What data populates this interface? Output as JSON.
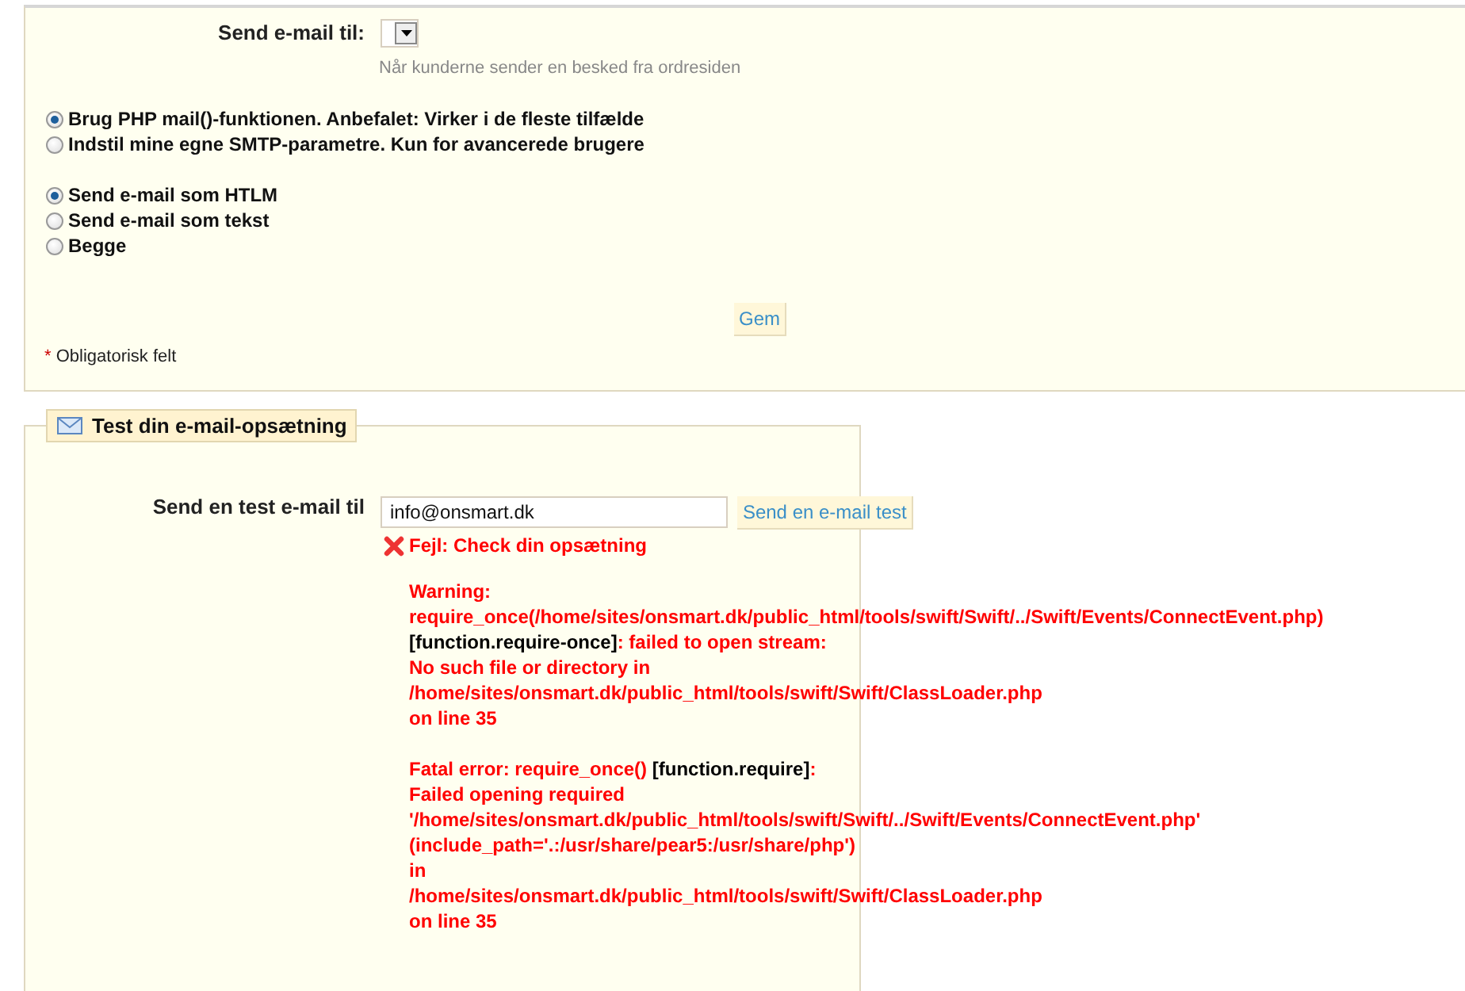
{
  "settings": {
    "send_to": {
      "label": "Send e-mail til:",
      "hint": "Når kunderne sender en besked fra ordresiden"
    },
    "mail_method": [
      {
        "label": "Brug PHP mail()-funktionen. Anbefalet: Virker i de fleste tilfælde",
        "selected": true
      },
      {
        "label": "Indstil mine egne SMTP-parametre. Kun for avancerede brugere",
        "selected": false
      }
    ],
    "mail_format": [
      {
        "label": "Send e-mail som HTLM",
        "selected": true
      },
      {
        "label": "Send e-mail som tekst",
        "selected": false
      },
      {
        "label": "Begge",
        "selected": false
      }
    ],
    "save_button": "Gem",
    "required_note": {
      "mark": "*",
      "text": "Obligatorisk felt"
    }
  },
  "test": {
    "legend": "Test din e-mail-opsætning",
    "label": "Send en test e-mail til",
    "email": "info@onsmart.dk",
    "button": "Send en e-mail test",
    "error": "Fejl: Check din opsætning",
    "messages": [
      [
        [
          {
            "kind": "text",
            "text": "Warning:"
          }
        ],
        [
          {
            "kind": "text",
            "text": "require_once(/home/sites/onsmart.dk/public_html/tools/swift/Swift/../Swift/Events/ConnectEvent.php)"
          }
        ],
        [
          {
            "kind": "link",
            "text": "[function.require-once]"
          },
          {
            "kind": "text",
            "text": ": failed to open stream:"
          }
        ],
        [
          {
            "kind": "text",
            "text": "No such file or directory in"
          }
        ],
        [
          {
            "kind": "text",
            "text": "/home/sites/onsmart.dk/public_html/tools/swift/Swift/ClassLoader.php"
          }
        ],
        [
          {
            "kind": "text",
            "text": "on line 35"
          }
        ]
      ],
      [
        [
          {
            "kind": "text",
            "text": "Fatal error: require_once() "
          },
          {
            "kind": "link",
            "text": "[function.require]"
          },
          {
            "kind": "text",
            "text": ":"
          }
        ],
        [
          {
            "kind": "text",
            "text": "Failed opening required"
          }
        ],
        [
          {
            "kind": "text",
            "text": "'/home/sites/onsmart.dk/public_html/tools/swift/Swift/../Swift/Events/ConnectEvent.php'"
          }
        ],
        [
          {
            "kind": "text",
            "text": "(include_path='.:/usr/share/pear5:/usr/share/php')"
          }
        ],
        [
          {
            "kind": "text",
            "text": "in"
          }
        ],
        [
          {
            "kind": "text",
            "text": "/home/sites/onsmart.dk/public_html/tools/swift/Swift/ClassLoader.php"
          }
        ],
        [
          {
            "kind": "text",
            "text": "on line 35"
          }
        ]
      ]
    ]
  }
}
